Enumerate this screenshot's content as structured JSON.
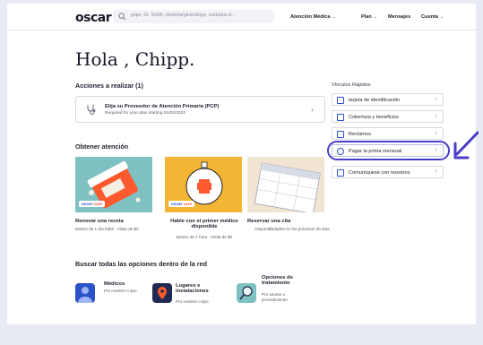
{
  "header": {
    "logo": "oscar",
    "search_placeholder": "gripe, Dr. Smith, obstetra/ginecólogo, cuidados d...",
    "nav": [
      {
        "label": "Atención Médica",
        "chevron": "⌄"
      },
      {
        "label": "Plan",
        "chevron": "⌄"
      },
      {
        "label": "Mensajes",
        "chevron": ""
      },
      {
        "label": "Cuenta",
        "chevron": "⌄"
      }
    ]
  },
  "greeting": "Hola , Chipp.",
  "actions": {
    "title": "Acciones a realizar (1)",
    "card": {
      "title": "Elija su Proveedor de Atención Primaria (PCP)",
      "subtitle": "Required for your plan starting 01/02/2022",
      "chevron": "›"
    }
  },
  "quick_links": {
    "title": "Vínculos Rápidos",
    "items": [
      {
        "label": "tarjeta de identificación",
        "icon": "id-card-icon",
        "chevron": "›"
      },
      {
        "label": "Cobertura y beneficios",
        "icon": "shield-icon",
        "chevron": "›"
      },
      {
        "label": "Reclamos",
        "icon": "document-icon",
        "chevron": "›"
      },
      {
        "label": "Pagar la prima mensual",
        "icon": "dollar-icon",
        "chevron": "›"
      },
      {
        "label": "Comuníquese con nosotros",
        "icon": "chat-icon",
        "chevron": "›"
      }
    ]
  },
  "care": {
    "title": "Obtener atención",
    "badge_prefix": "oscar",
    "badge_suffix": "care",
    "cards": [
      {
        "label": "Renovar una receta",
        "sub": "Dentro de 1 día hábil · Visita de $0"
      },
      {
        "label": "Hable con el primer médico disponible",
        "sub": "Dentro de 1 hora · Visita de $0"
      },
      {
        "label": "Reservar una cita",
        "sub": "Disponibilidades en los próximos 30 días"
      }
    ]
  },
  "network": {
    "title": "Buscar todas las opciones dentro de la red",
    "items": [
      {
        "label": "Médicos",
        "sub": "Por nombre o tipo"
      },
      {
        "label": "Lugares e instalaciones",
        "sub": "Por nombre o tipo"
      },
      {
        "label": "Opciones de tratamiento",
        "sub": "Por asunto o procedimiento"
      }
    ]
  },
  "colors": {
    "accent": "#2c52c9",
    "highlight": "#4a3ec8",
    "card_teal": "#7fc0c2",
    "card_yellow": "#f2b634",
    "card_cream": "#f2e4d3",
    "orange": "#ff4f3f"
  }
}
